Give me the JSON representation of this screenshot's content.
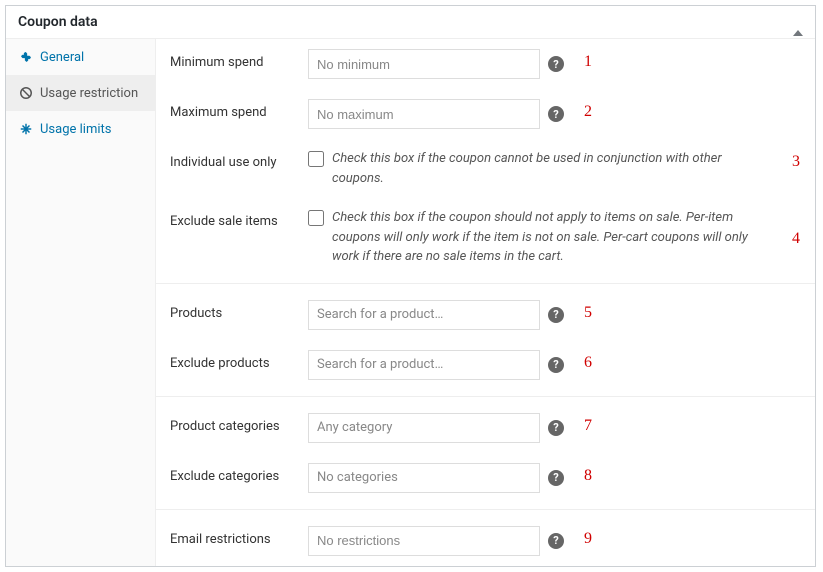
{
  "panel": {
    "title": "Coupon data"
  },
  "sidebar": {
    "items": [
      {
        "label": "General",
        "icon": "ticket-icon"
      },
      {
        "label": "Usage restriction",
        "icon": "ban-icon"
      },
      {
        "label": "Usage limits",
        "icon": "limits-icon"
      }
    ]
  },
  "fields": {
    "min_spend": {
      "label": "Minimum spend",
      "placeholder": "No minimum",
      "annot": "1"
    },
    "max_spend": {
      "label": "Maximum spend",
      "placeholder": "No maximum",
      "annot": "2"
    },
    "individual": {
      "label": "Individual use only",
      "desc": "Check this box if the coupon cannot be used in conjunction with other coupons.",
      "annot": "3"
    },
    "exclude_sale": {
      "label": "Exclude sale items",
      "desc": "Check this box if the coupon should not apply to items on sale. Per-item coupons will only work if the item is not on sale. Per-cart coupons will only work if there are no sale items in the cart.",
      "annot": "4"
    },
    "products": {
      "label": "Products",
      "placeholder": "Search for a product…",
      "annot": "5"
    },
    "exclude_products": {
      "label": "Exclude products",
      "placeholder": "Search for a product…",
      "annot": "6"
    },
    "categories": {
      "label": "Product categories",
      "placeholder": "Any category",
      "annot": "7"
    },
    "exclude_categories": {
      "label": "Exclude categories",
      "placeholder": "No categories",
      "annot": "8"
    },
    "email": {
      "label": "Email restrictions",
      "placeholder": "No restrictions",
      "annot": "9"
    }
  }
}
